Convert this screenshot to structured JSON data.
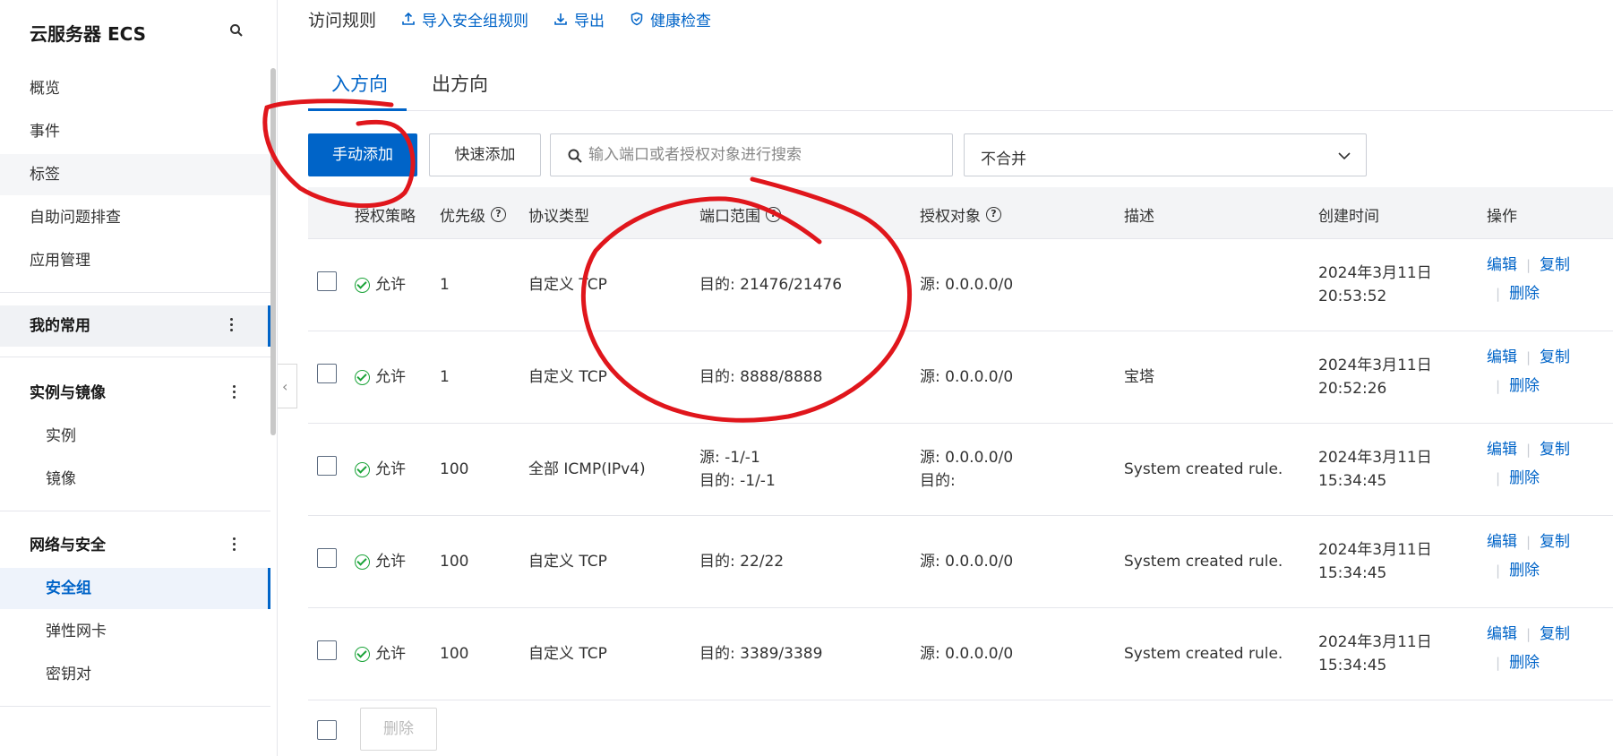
{
  "sidebar": {
    "title": "云服务器 ECS",
    "items": [
      {
        "label": "概览"
      },
      {
        "label": "事件"
      },
      {
        "label": "标签"
      },
      {
        "label": "自助问题排查"
      },
      {
        "label": "应用管理"
      }
    ],
    "favorites_label": "我的常用",
    "groups": [
      {
        "label": "实例与镜像",
        "children": [
          "实例",
          "镜像"
        ]
      },
      {
        "label": "网络与安全",
        "children": [
          "安全组",
          "弹性网卡",
          "密钥对"
        ]
      }
    ],
    "active_item": "安全组"
  },
  "topbar": {
    "title": "访问规则",
    "import_label": "导入安全组规则",
    "export_label": "导出",
    "health_label": "健康检查"
  },
  "tabs": {
    "inbound": "入方向",
    "outbound": "出方向"
  },
  "toolbar": {
    "manual_add": "手动添加",
    "quick_add": "快速添加",
    "search_placeholder": "输入端口或者授权对象进行搜索",
    "merge_select": "不合并"
  },
  "table": {
    "headers": {
      "policy": "授权策略",
      "priority": "优先级",
      "protocol": "协议类型",
      "port": "端口范围",
      "target": "授权对象",
      "desc": "描述",
      "created": "创建时间",
      "ops": "操作"
    },
    "rows": [
      {
        "policy": "允许",
        "priority": "1",
        "protocol": "自定义 TCP",
        "port": "目的: 21476/21476",
        "port2": "",
        "target": "源: 0.0.0.0/0",
        "target2": "",
        "desc": "",
        "date": "2024年3月11日",
        "time": "20:53:52"
      },
      {
        "policy": "允许",
        "priority": "1",
        "protocol": "自定义 TCP",
        "port": "目的: 8888/8888",
        "port2": "",
        "target": "源: 0.0.0.0/0",
        "target2": "",
        "desc": "宝塔",
        "date": "2024年3月11日",
        "time": "20:52:26"
      },
      {
        "policy": "允许",
        "priority": "100",
        "protocol": "全部 ICMP(IPv4)",
        "port": "源: -1/-1",
        "port2": "目的: -1/-1",
        "target": "源: 0.0.0.0/0",
        "target2": "目的:",
        "desc": "System created rule.",
        "date": "2024年3月11日",
        "time": "15:34:45"
      },
      {
        "policy": "允许",
        "priority": "100",
        "protocol": "自定义 TCP",
        "port": "目的: 22/22",
        "port2": "",
        "target": "源: 0.0.0.0/0",
        "target2": "",
        "desc": "System created rule.",
        "date": "2024年3月11日",
        "time": "15:34:45"
      },
      {
        "policy": "允许",
        "priority": "100",
        "protocol": "自定义 TCP",
        "port": "目的: 3389/3389",
        "port2": "",
        "target": "源: 0.0.0.0/0",
        "target2": "",
        "desc": "System created rule.",
        "date": "2024年3月11日",
        "time": "15:34:45"
      }
    ],
    "op_edit": "编辑",
    "op_copy": "复制",
    "op_delete": "删除",
    "op_sep": "|"
  },
  "footer": {
    "delete_label": "删除"
  },
  "colors": {
    "accent": "#0064c8",
    "allow_green": "#1aa338",
    "annotation_red": "#e0161c"
  }
}
